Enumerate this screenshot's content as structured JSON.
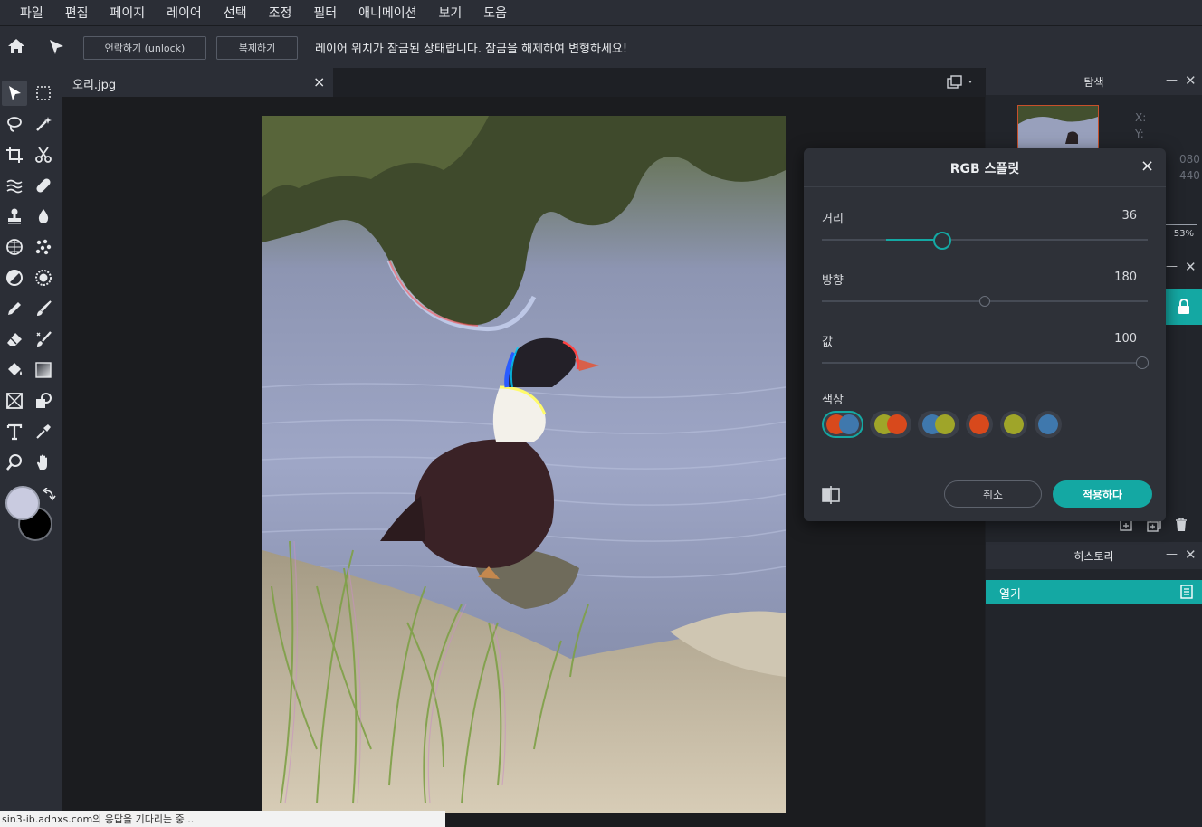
{
  "menu": [
    "파일",
    "편집",
    "페이지",
    "레이어",
    "선택",
    "조정",
    "필터",
    "애니메이션",
    "보기",
    "도움"
  ],
  "options": {
    "unlock_label": "언락하기 (unlock)",
    "duplicate_label": "복제하기",
    "message": "레이어 위치가 잠금된 상태랍니다. 잠금을 해제하여 변형하세요!"
  },
  "tab": {
    "name": "오리.jpg",
    "close": "×"
  },
  "navigator": {
    "title": "탐색",
    "x_label": "X:",
    "y_label": "Y:",
    "w_partial": "080",
    "h_partial": "440",
    "zoom_partial": "53%"
  },
  "history": {
    "title": "히스토리",
    "items": [
      "열기"
    ]
  },
  "dialog": {
    "title": "RGB 스플릿",
    "close": "×",
    "distance": {
      "label": "거리",
      "value": "36",
      "fraction": 0.37
    },
    "direction": {
      "label": "방향",
      "value": "180",
      "fraction": 0.5
    },
    "amount": {
      "label": "값",
      "value": "100",
      "fraction": 1.0
    },
    "color_label": "색상",
    "swatches": [
      [
        "#d8491c",
        "#3f78ad"
      ],
      [
        "#9fa529",
        "#d8491c"
      ],
      [
        "#3f78ad",
        "#9fa529"
      ],
      [
        "#d8491c"
      ],
      [
        "#9fa529"
      ],
      [
        "#3f78ad"
      ]
    ],
    "selected_swatch": 0,
    "cancel_label": "취소",
    "apply_label": "적용하다"
  },
  "colors": {
    "accent": "#14a8a3",
    "primary_color": "#c9cbe0",
    "secondary_color": "#000000"
  },
  "status_text": "sin3-ib.adnxs.com의 응답을 기다리는 중..."
}
